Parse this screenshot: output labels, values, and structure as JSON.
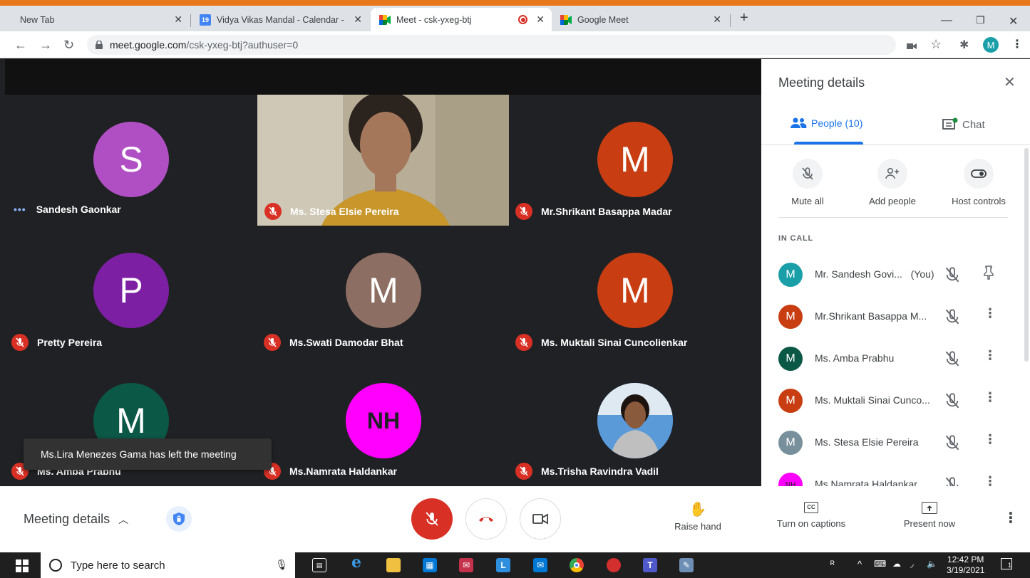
{
  "browser": {
    "tabs": [
      {
        "title": "New Tab",
        "active": false
      },
      {
        "title": "Vidya Vikas Mandal - Calendar -",
        "active": false,
        "favicon_text": "19"
      },
      {
        "title": "Meet - csk-yxeg-btj",
        "active": true,
        "recording": true
      },
      {
        "title": "Google Meet",
        "active": false
      }
    ],
    "url_host": "meet.google.com",
    "url_path": "/csk-yxeg-btj?authuser=0",
    "profile_initial": "M"
  },
  "tiles": [
    {
      "name": "Sandesh Gaonkar",
      "initial": "S",
      "color": "#b04fc3",
      "speaking": true
    },
    {
      "name": "Ms. Stesa Elsie Pereira",
      "video": true
    },
    {
      "name": "Mr.Shrikant Basappa Madar",
      "initial": "M",
      "color": "#c83e12"
    },
    {
      "name": "Pretty Pereira",
      "initial": "P",
      "color": "#7d1fa3"
    },
    {
      "name": "Ms.Swati Damodar Bhat",
      "initial": "M",
      "color": "#8d6e63"
    },
    {
      "name": "Ms. Muktali Sinai Cuncolienkar",
      "initial": "M",
      "color": "#c83e12"
    },
    {
      "name": "Ms. Amba Prabhu",
      "initial": "M",
      "color": "#0b5846"
    },
    {
      "name": "Ms.Namrata Haldankar",
      "initial": "NH",
      "color": "#ff00ff"
    },
    {
      "name": "Ms.Trisha Ravindra Vadil",
      "photo": true
    }
  ],
  "toast": "Ms.Lira Menezes Gama has left the meeting",
  "panel": {
    "title": "Meeting details",
    "tab_people": "People (10)",
    "tab_chat": "Chat",
    "actions": {
      "mute_all": "Mute all",
      "add_people": "Add people",
      "host_controls": "Host controls"
    },
    "in_call_label": "IN CALL",
    "participants": [
      {
        "name": "Mr. Sandesh Govi...",
        "suffix": "(You)",
        "initial": "M",
        "color": "#1a9fa8",
        "pin": true
      },
      {
        "name": "Mr.Shrikant Basappa M...",
        "initial": "M",
        "color": "#c83e12"
      },
      {
        "name": "Ms. Amba Prabhu",
        "initial": "M",
        "color": "#0b5846"
      },
      {
        "name": "Ms. Muktali Sinai Cunco...",
        "initial": "M",
        "color": "#c83e12"
      },
      {
        "name": "Ms. Stesa Elsie Pereira",
        "initial": "M",
        "color": "#78909c"
      },
      {
        "name": "Ms.Namrata Haldankar",
        "initial": "NH",
        "color": "#ff00ff"
      }
    ]
  },
  "bottom": {
    "meeting_details": "Meeting details",
    "raise_hand": "Raise hand",
    "captions": "Turn on captions",
    "present": "Present now"
  },
  "taskbar": {
    "search_placeholder": "Type here to search",
    "time": "12:42 PM",
    "date": "3/19/2021",
    "notification_count": "1"
  }
}
